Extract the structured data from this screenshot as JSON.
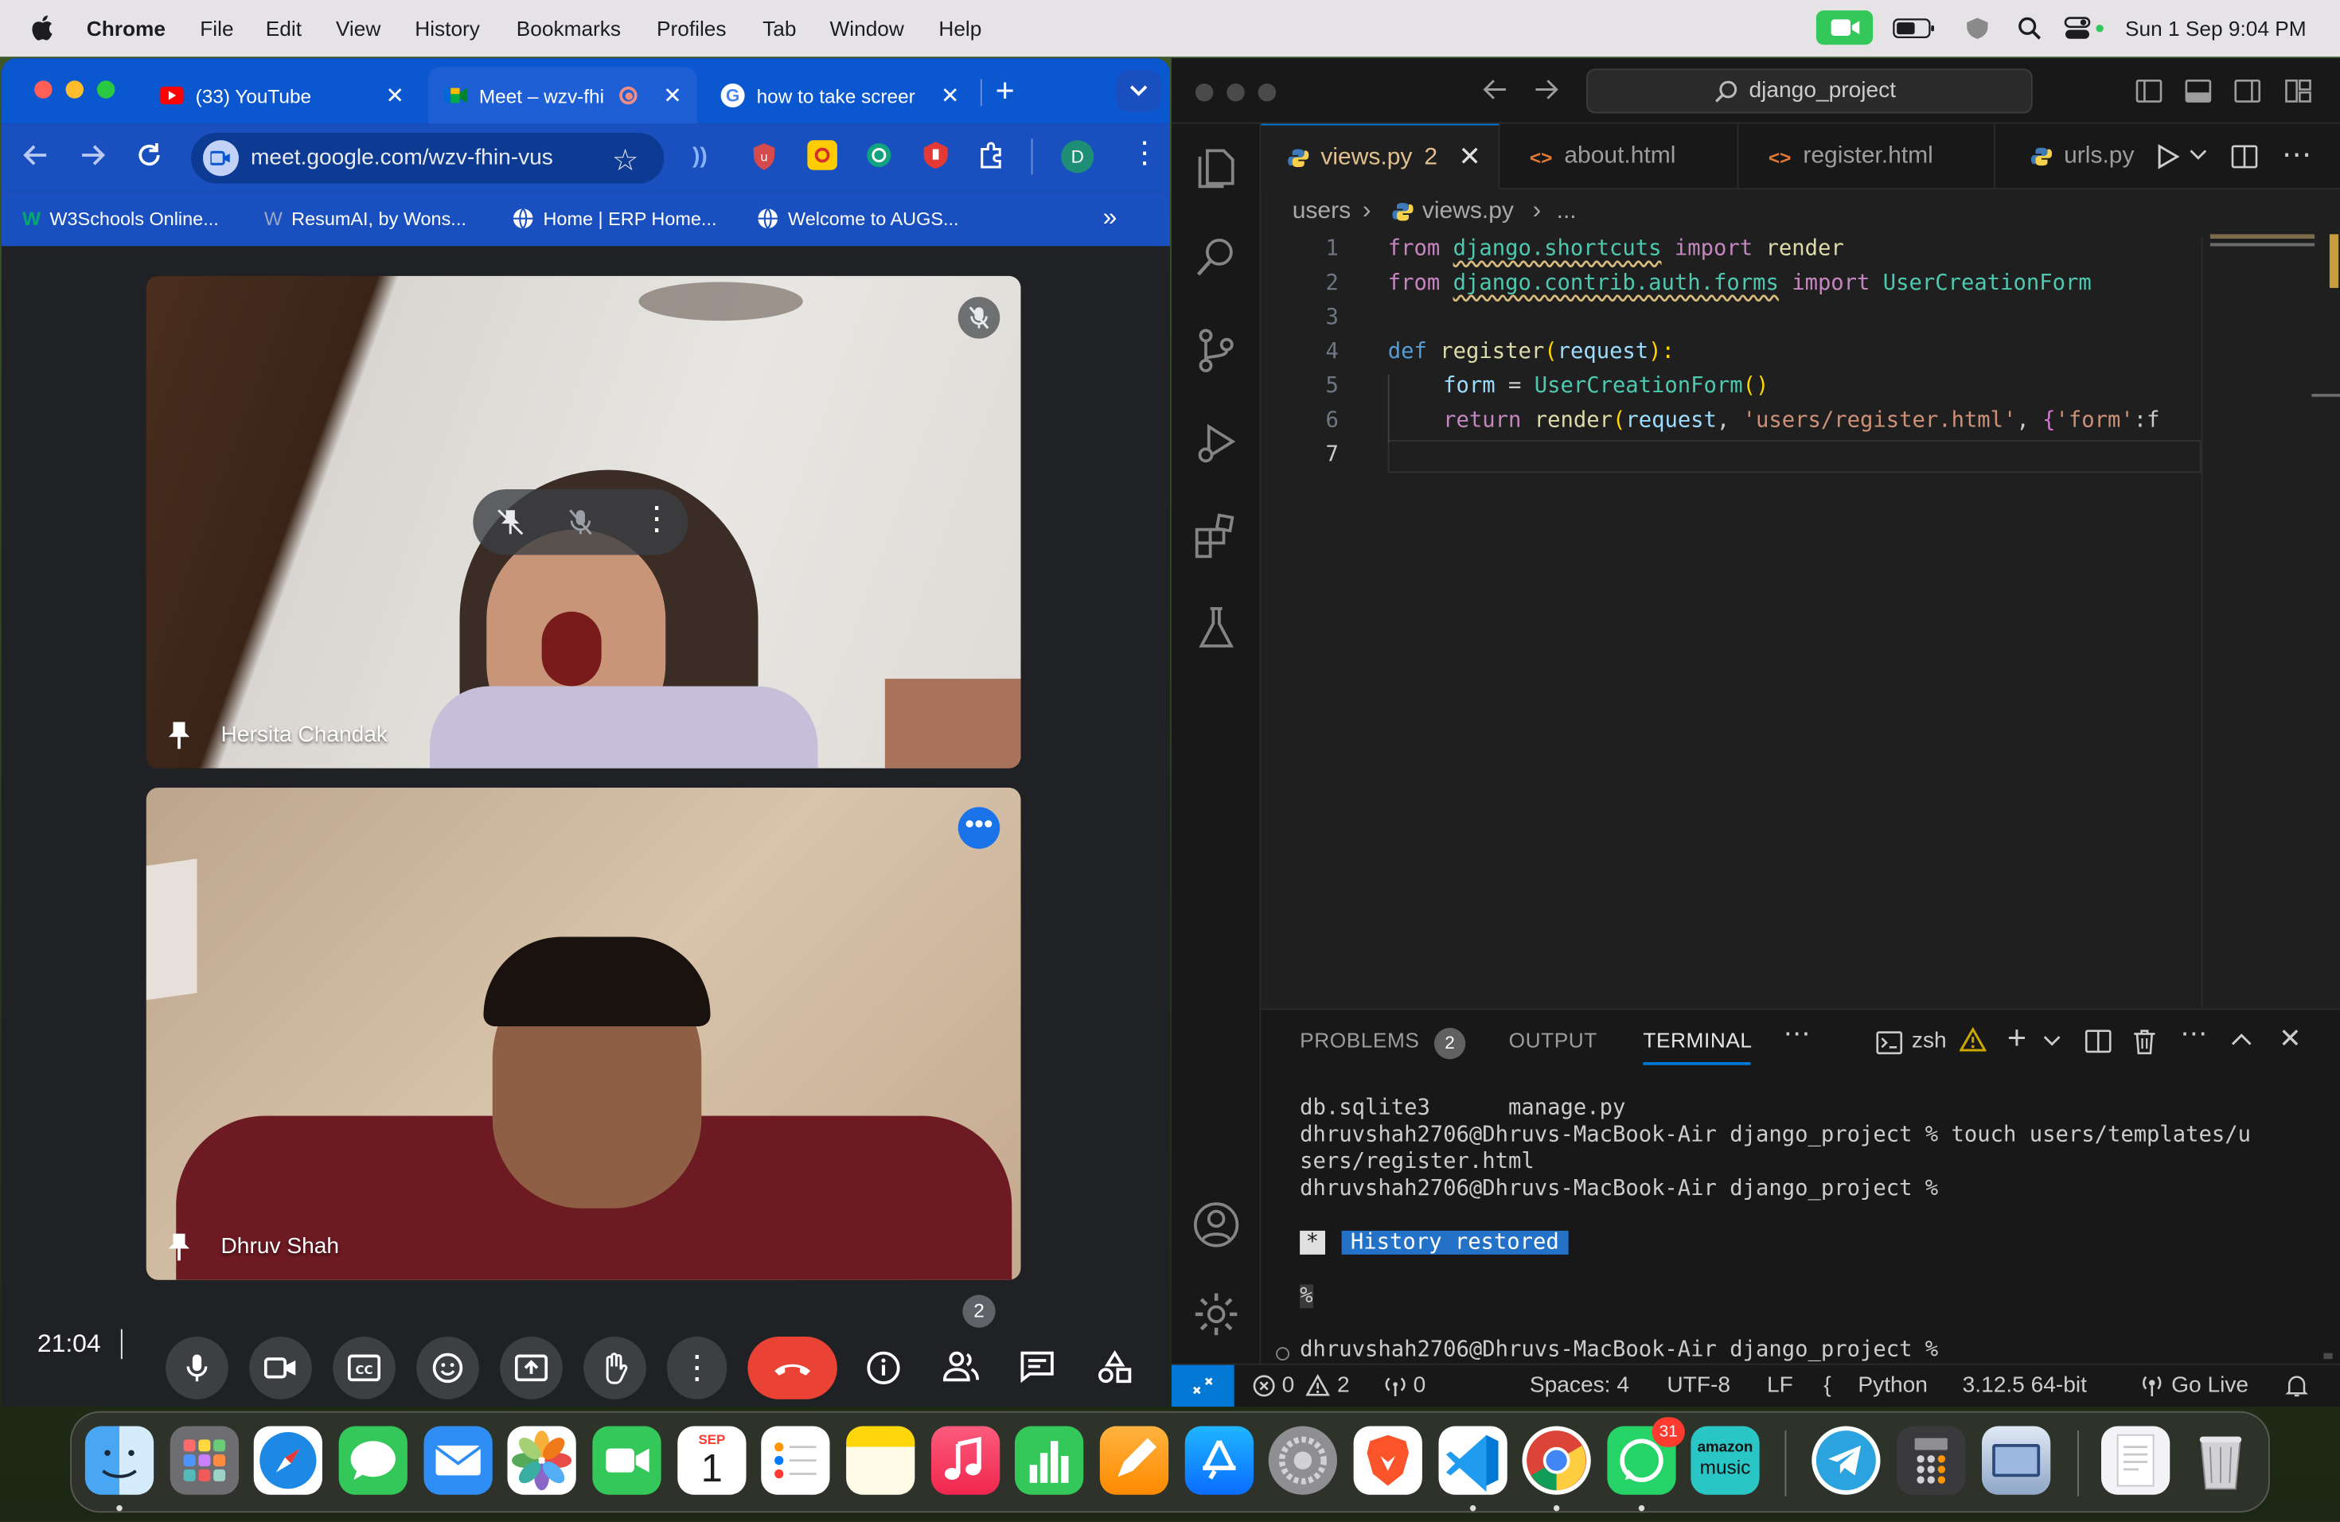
{
  "menubar": {
    "app": "Chrome",
    "items": [
      "File",
      "Edit",
      "View",
      "History",
      "Bookmarks",
      "Profiles",
      "Tab",
      "Window",
      "Help"
    ],
    "datetime": "Sun 1 Sep  9:04 PM"
  },
  "chrome": {
    "tabs": [
      {
        "title": "(33) YouTube"
      },
      {
        "title": "Meet – wzv-fhi"
      },
      {
        "title": "how to take screer"
      }
    ],
    "url": "meet.google.com/wzv-fhin-vus",
    "profile_initial": "D",
    "bookmarks": [
      "W3Schools Online...",
      "ResumAI, by Wons...",
      "Home | ERP Home...",
      "Welcome to AUGS..."
    ]
  },
  "meet": {
    "participants": [
      {
        "name": "Hersita Chandak"
      },
      {
        "name": "Dhruv Shah"
      }
    ],
    "clock": "21:04",
    "people_count": "2"
  },
  "vscode": {
    "search": "django_project",
    "tabs": [
      {
        "label": "views.py",
        "badge": "2"
      },
      {
        "label": "about.html"
      },
      {
        "label": "register.html"
      },
      {
        "label": "urls.py"
      }
    ],
    "breadcrumb": {
      "folder": "users",
      "file": "views.py",
      "more": "..."
    },
    "line_numbers": [
      "1",
      "2",
      "3",
      "4",
      "5",
      "6",
      "7"
    ],
    "code": {
      "l1": {
        "kw": "from",
        "mod": "django.shortcuts",
        "kw2": "import",
        "name": "render"
      },
      "l2": {
        "kw": "from",
        "mod": "django.contrib.auth.forms",
        "kw2": "import",
        "name": "UserCreationForm"
      },
      "l4": {
        "kw": "def",
        "fn": "register",
        "p1": "(",
        "arg": "request",
        "p2": "):"
      },
      "l5": {
        "var": "form",
        "op": " = ",
        "cls": "UserCreationForm",
        "p": "()"
      },
      "l6": {
        "kw": "return",
        "fn": "render",
        "p1": "(",
        "arg": "request",
        "c1": ", ",
        "str": "'users/register.html'",
        "c2": ", ",
        "b": "{",
        "key": "'form'",
        "rest": ":f"
      }
    },
    "panel": {
      "tabs": [
        "PROBLEMS",
        "OUTPUT",
        "TERMINAL"
      ],
      "problems_count": "2",
      "shell": "zsh",
      "lines": [
        "db.sqlite3      manage.py",
        "dhruvshah2706@Dhruvs-MacBook-Air django_project % touch users/templates/u",
        "sers/register.html",
        "dhruvshah2706@Dhruvs-MacBook-Air django_project %"
      ],
      "history_star": "*",
      "history_text": "History restored",
      "prompt_char": "%",
      "last_prompt": "dhruvshah2706@Dhruvs-MacBook-Air django_project %"
    },
    "status": {
      "errors": "0",
      "warnings": "2",
      "ports": "0",
      "spaces": "Spaces: 4",
      "encoding": "UTF-8",
      "eol": "LF",
      "language": "Python",
      "interpreter": "3.12.5 64-bit",
      "golive": "Go Live"
    }
  },
  "dock": {
    "calendar_month": "SEP",
    "calendar_day": "1",
    "whatsapp_badge": "31",
    "amazon_top": "amazon",
    "amazon_bottom": "music"
  },
  "colors": {
    "chrome_blue": "#0b57d0",
    "meet_bg": "#202124",
    "end_call": "#ea4335",
    "vscode_bg": "#1f1f1f",
    "accent": "#0078d4",
    "facetime_green": "#34c759"
  }
}
